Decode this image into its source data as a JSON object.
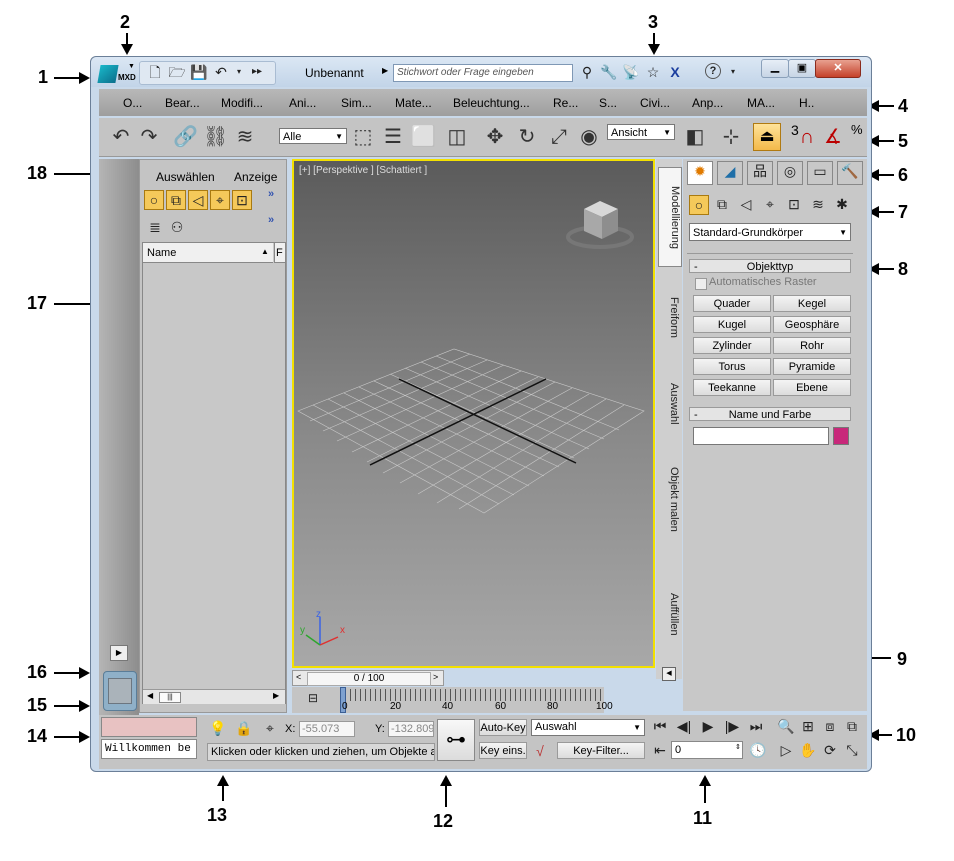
{
  "callouts": {
    "c1": "1",
    "c2": "2",
    "c3": "3",
    "c4": "4",
    "c5": "5",
    "c6": "6",
    "c7": "7",
    "c8": "8",
    "c9": "9",
    "c10": "10",
    "c11": "11",
    "c12": "12",
    "c13": "13",
    "c14": "14",
    "c15": "15",
    "c16": "16",
    "c17": "17",
    "c18": "18"
  },
  "titlebar": {
    "app_badge": "MXD",
    "title": "Unbenannt",
    "search_placeholder": "Stichwort oder Frage eingeben"
  },
  "menu": [
    "O...",
    "Bear...",
    "Modifi...",
    "Ani...",
    "Sim...",
    "Mate...",
    "Beleuchtung...",
    "Re...",
    "S...",
    "Civi...",
    "Anp...",
    "MA...",
    "H.."
  ],
  "toolbar": {
    "selection_filter": "Alle",
    "reference_coord": "Ansicht",
    "snap_label": "3",
    "percent_label": "%"
  },
  "scene_explorer": {
    "menu_select": "Auswählen",
    "menu_display": "Anzeige",
    "more": "»",
    "col_name": "Name",
    "col_f": "F",
    "sort_arrow": "▲"
  },
  "viewport": {
    "label": "[+] [Perspektive ] [Schattiert ]",
    "axis_x": "x",
    "axis_y": "y",
    "axis_z": "z"
  },
  "ribbon_tabs": [
    "Modellierung",
    "Freiform",
    "Auswahl",
    "Objekt malen",
    "Auffüllen"
  ],
  "command_panel": {
    "category": "Standard-Grundkörper",
    "rollout_objecttype": "Objekttyp",
    "auto_grid": "Automatisches Raster",
    "buttons": [
      "Quader",
      "Kegel",
      "Kugel",
      "Geosphäre",
      "Zylinder",
      "Rohr",
      "Torus",
      "Pyramide",
      "Teekanne",
      "Ebene"
    ],
    "rollout_namecolor": "Name und Farbe",
    "name_value": "",
    "color_swatch": "#c8287a",
    "minus": "-"
  },
  "timeline": {
    "frame_counter": "0 / 100",
    "ticks": [
      "0",
      "20",
      "40",
      "60",
      "80",
      "100"
    ]
  },
  "status": {
    "maxscript_text": "Willkommen be",
    "x_label": "X:",
    "x_value": "-55.073",
    "y_label": "Y:",
    "y_value": "-132.809",
    "prompt": "Klicken oder klicken und ziehen, um Objekte a",
    "auto_key": "Auto-Key",
    "set_key": "Key eins.",
    "selection_set": "Auswahl",
    "key_filters": "Key-Filter...",
    "frame_field": "0"
  }
}
